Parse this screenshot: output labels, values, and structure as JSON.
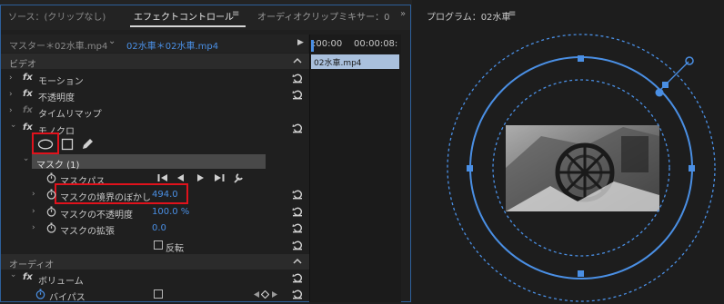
{
  "tabs": {
    "source": "ソース：(クリップなし)",
    "effect_controls": "エフェクトコントロール",
    "effect_controls_menu": "≡",
    "audio_mixer": "オーディオクリップミキサー：0",
    "overflow": "»"
  },
  "clip_header": {
    "master": "マスター＊02水車.mp4",
    "chevron": "⌄",
    "current": "02水車＊02水車.mp4",
    "play": "▶"
  },
  "timeline": {
    "time_start": ":00:00",
    "time_end": "00:00:08:",
    "clip_name": "02水車.mp4"
  },
  "sections": {
    "video": "ビデオ",
    "audio": "オーディオ"
  },
  "effects": {
    "fx_symbol": "fx",
    "motion": "モーション",
    "opacity": "不透明度",
    "time_remap": "タイムリマップ",
    "mono": "モノクロ",
    "volume": "ボリューム",
    "bypass": "バイパス"
  },
  "mask": {
    "title": "マスク (1)",
    "path_label": "マスクパス",
    "feather_label": "マスクの境界のぼかし",
    "feather_value": "494.0",
    "opacity_label": "マスクの不透明度",
    "opacity_value": "100.0 %",
    "expansion_label": "マスクの拡張",
    "expansion_value": "0.0",
    "inverted_label": "反転",
    "inverted_checked": false
  },
  "program": {
    "title": "プログラム：02水車",
    "menu": "≡"
  },
  "colors": {
    "accent_blue": "#4a8fe4",
    "highlight_red": "#e0121c",
    "panel_border": "#2d5f9a"
  }
}
